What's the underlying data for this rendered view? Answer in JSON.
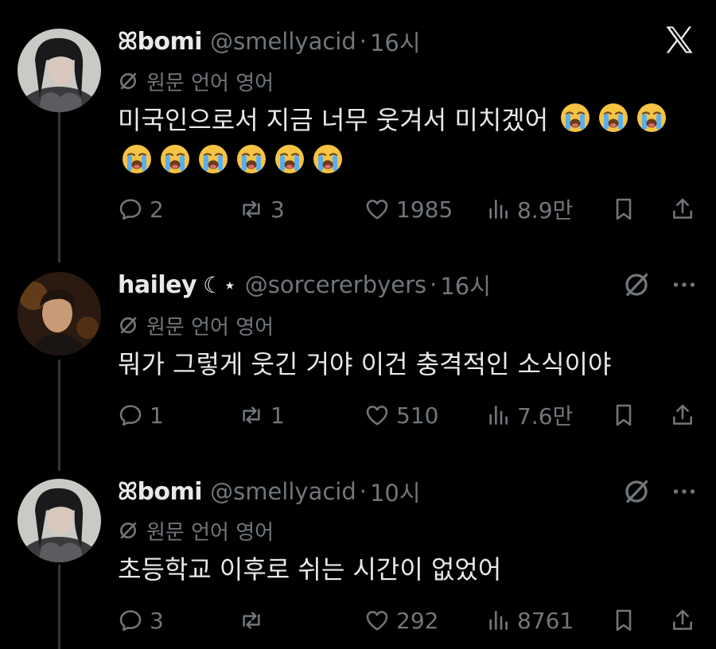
{
  "tweets": [
    {
      "name": "ꕤbomi",
      "handle": "@smellyacid",
      "time": "16시",
      "translate": "원문 언어 영어",
      "text": "미국인으로서 지금 너무 웃겨서 미치겠어",
      "emoji_name": "loudly-crying-face",
      "emoji_count": 9,
      "stats": {
        "replies": "2",
        "reposts": "3",
        "likes": "1985",
        "views": "8.9만"
      }
    },
    {
      "name": "hailey",
      "name_deco": "☾⋆",
      "handle": "@sorcererbyers",
      "time": "16시",
      "translate": "원문 언어 영어",
      "text": "뭐가 그렇게 웃긴 거야 이건 충격적인 소식이야",
      "stats": {
        "replies": "1",
        "reposts": "1",
        "likes": "510",
        "views": "7.6만"
      }
    },
    {
      "name": "ꕤbomi",
      "handle": "@smellyacid",
      "time": "10시",
      "translate": "원문 언어 영어",
      "text": "초등학교 이후로 쉬는 시간이 없었어",
      "stats": {
        "replies": "3",
        "reposts": "",
        "likes": "292",
        "views": "8761"
      }
    }
  ],
  "separator": "·",
  "colors": {
    "background": "#000000",
    "text": "#e7e9ea",
    "muted": "#71767b",
    "thread_line": "#333639"
  },
  "icons": [
    "x-logo-icon",
    "translate-slash-icon",
    "reply-icon",
    "repost-icon",
    "like-icon",
    "views-icon",
    "bookmark-icon",
    "share-icon",
    "more-icon"
  ]
}
